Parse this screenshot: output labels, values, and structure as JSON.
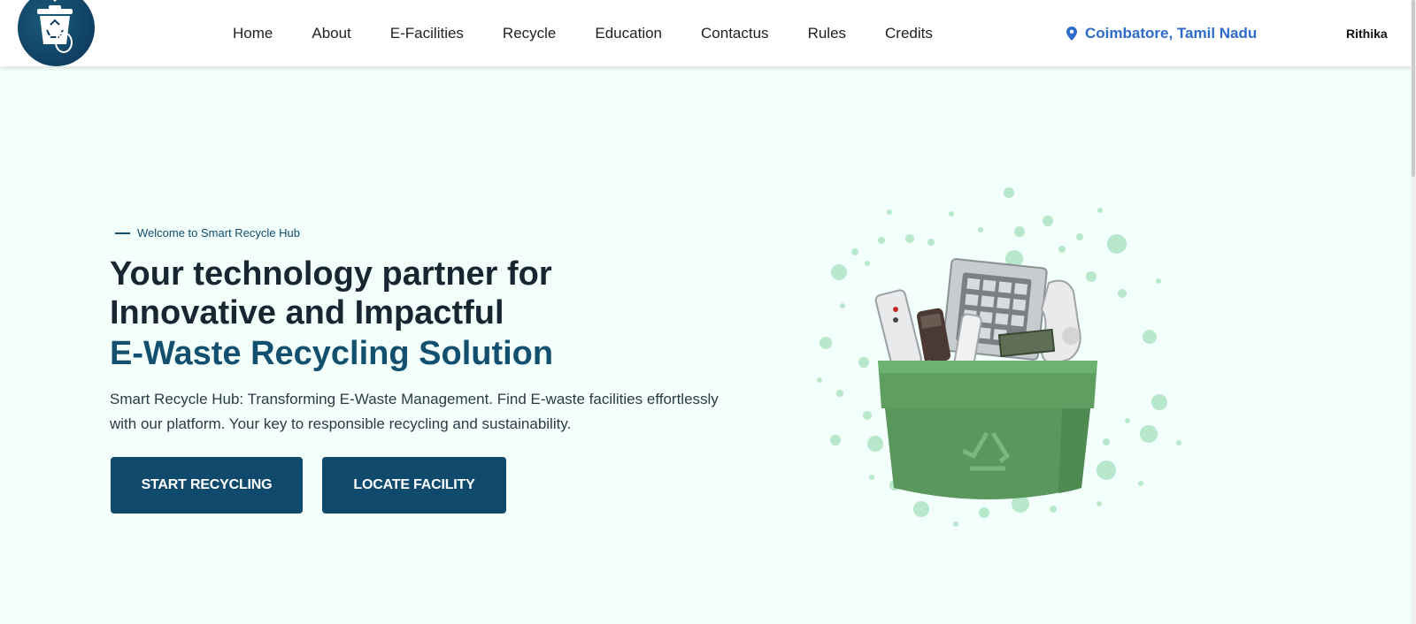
{
  "header": {
    "nav": [
      "Home",
      "About",
      "E-Facilities",
      "Recycle",
      "Education",
      "Contactus",
      "Rules",
      "Credits"
    ],
    "location": "Coimbatore, Tamil Nadu",
    "user": "Rithika"
  },
  "hero": {
    "eyebrow": "Welcome to Smart Recycle Hub",
    "headline_line1": "Your technology partner for",
    "headline_line2": "Innovative and Impactful",
    "headline_accent": "E-Waste Recycling Solution",
    "subtext": "Smart Recycle Hub: Transforming E-Waste Management. Find E-waste facilities effortlessly with our platform. Your key to responsible recycling and sustainability.",
    "primary_button": "START RECYCLING",
    "secondary_button": "LOCATE FACILITY"
  },
  "colors": {
    "page_background": "#f3fffb",
    "brand_dark": "#0f4a6c",
    "location_blue": "#2f6cc9",
    "bin_green": "#5fa060",
    "dots_green": "#b7e8cc"
  },
  "icons": {
    "logo": "recycle-bin-logo",
    "location": "map-pin-icon",
    "illustration": "e-waste-bin-illustration"
  }
}
